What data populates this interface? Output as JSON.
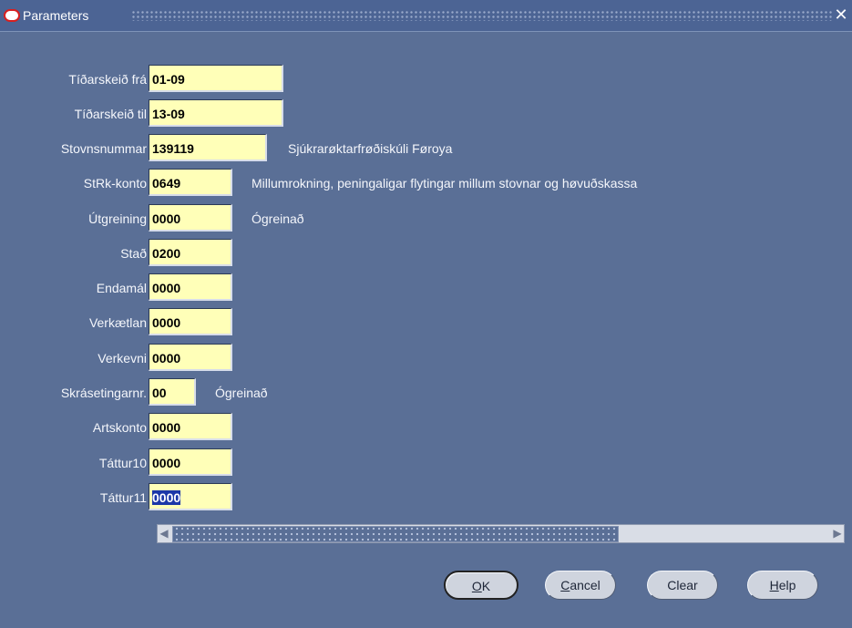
{
  "window": {
    "title": "Parameters",
    "close_glyph": "✕"
  },
  "fields": [
    {
      "label": "Tíðarskeið frá",
      "value": "01-09",
      "desc": ""
    },
    {
      "label": "Tíðarskeið til",
      "value": "13-09",
      "desc": ""
    },
    {
      "label": "Stovnsnummar",
      "value": "139119",
      "desc": "Sjúkrarøktarfrøðiskúli Føroya"
    },
    {
      "label": "StRk-konto",
      "value": "0649",
      "desc": "Millumrokning, peningaligar flytingar millum stovnar og høvuðskassa"
    },
    {
      "label": "Útgreining",
      "value": "0000",
      "desc": "Ógreinað"
    },
    {
      "label": "Stað",
      "value": "0200",
      "desc": ""
    },
    {
      "label": "Endamál",
      "value": "0000",
      "desc": ""
    },
    {
      "label": "Verkætlan",
      "value": "0000",
      "desc": ""
    },
    {
      "label": "Verkevni",
      "value": "0000",
      "desc": ""
    },
    {
      "label": "Skrásetingarnr.",
      "value": "00",
      "desc": "Ógreinað"
    },
    {
      "label": "Artskonto",
      "value": "0000",
      "desc": ""
    },
    {
      "label": "Táttur10",
      "value": "0000",
      "desc": ""
    },
    {
      "label": "Táttur11",
      "value": "0000",
      "desc": ""
    }
  ],
  "scrollbar": {
    "left_arrow": "◀",
    "right_arrow": "▶"
  },
  "buttons": {
    "ok": {
      "mnemonic": "O",
      "rest": "K"
    },
    "cancel": {
      "mnemonic": "C",
      "rest": "ancel"
    },
    "clear": {
      "label": "Clear"
    },
    "help": {
      "mnemonic": "H",
      "rest": "elp"
    }
  },
  "colors": {
    "background": "#5a6f96",
    "field_fill": "#ffffb8",
    "selection": "#1b37a8"
  }
}
